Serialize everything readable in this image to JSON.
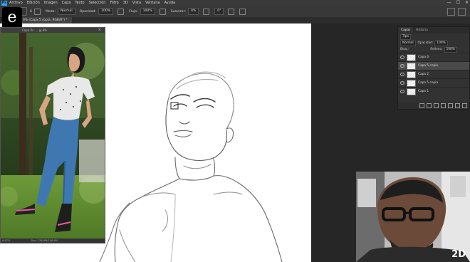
{
  "menubar": {
    "app_icon": "Ps",
    "items": [
      "Archivo",
      "Edición",
      "Imagen",
      "Capa",
      "Texto",
      "Selección",
      "Filtro",
      "3D",
      "Vista",
      "Ventana",
      "Ayuda"
    ],
    "window_controls": [
      "—",
      "☐",
      "✕"
    ]
  },
  "options": {
    "size_value": "6",
    "mode_label": "Modo:",
    "mode_value": "Normal",
    "opacity_label": "Opacidad:",
    "opacity_value": "100%",
    "flow_label": "Flujo:",
    "flow_value": "100%",
    "smoothing_label": "Suavizar:",
    "smoothing_value": "0%",
    "angle_value": "0°"
  },
  "tab": {
    "title": "0% (Capa 5 copia, RGB/8*) *"
  },
  "overlay": {
    "logo": "e"
  },
  "photo_window": {
    "title": "Capa Ps .... @ 8%",
    "close": "×",
    "zoom": "6.47%",
    "doc": "Doc: 136.9M/146.9M"
  },
  "layers_panel": {
    "tabs": [
      "Capas",
      "Historia"
    ],
    "filter": "Tipo",
    "blend_mode": "Normal",
    "opacity_label": "Opacidad:",
    "opacity_value": "100%",
    "lock_label": "Bloq.:",
    "fill_label": "Relleno:",
    "fill_value": "100%",
    "layers": [
      {
        "name": "Capa 6",
        "selected": false
      },
      {
        "name": "Capa 5 copia",
        "selected": true
      },
      {
        "name": "Capa 2",
        "selected": false
      },
      {
        "name": "Capa 5 copia",
        "selected": false
      },
      {
        "name": "Capa 1",
        "selected": false
      }
    ]
  },
  "webcam": {
    "brand": "2D"
  },
  "colors": {
    "accent": "#31a8ff",
    "canvas": "#ffffff",
    "workspace": "#262626",
    "chrome": "#3a3a3a"
  }
}
